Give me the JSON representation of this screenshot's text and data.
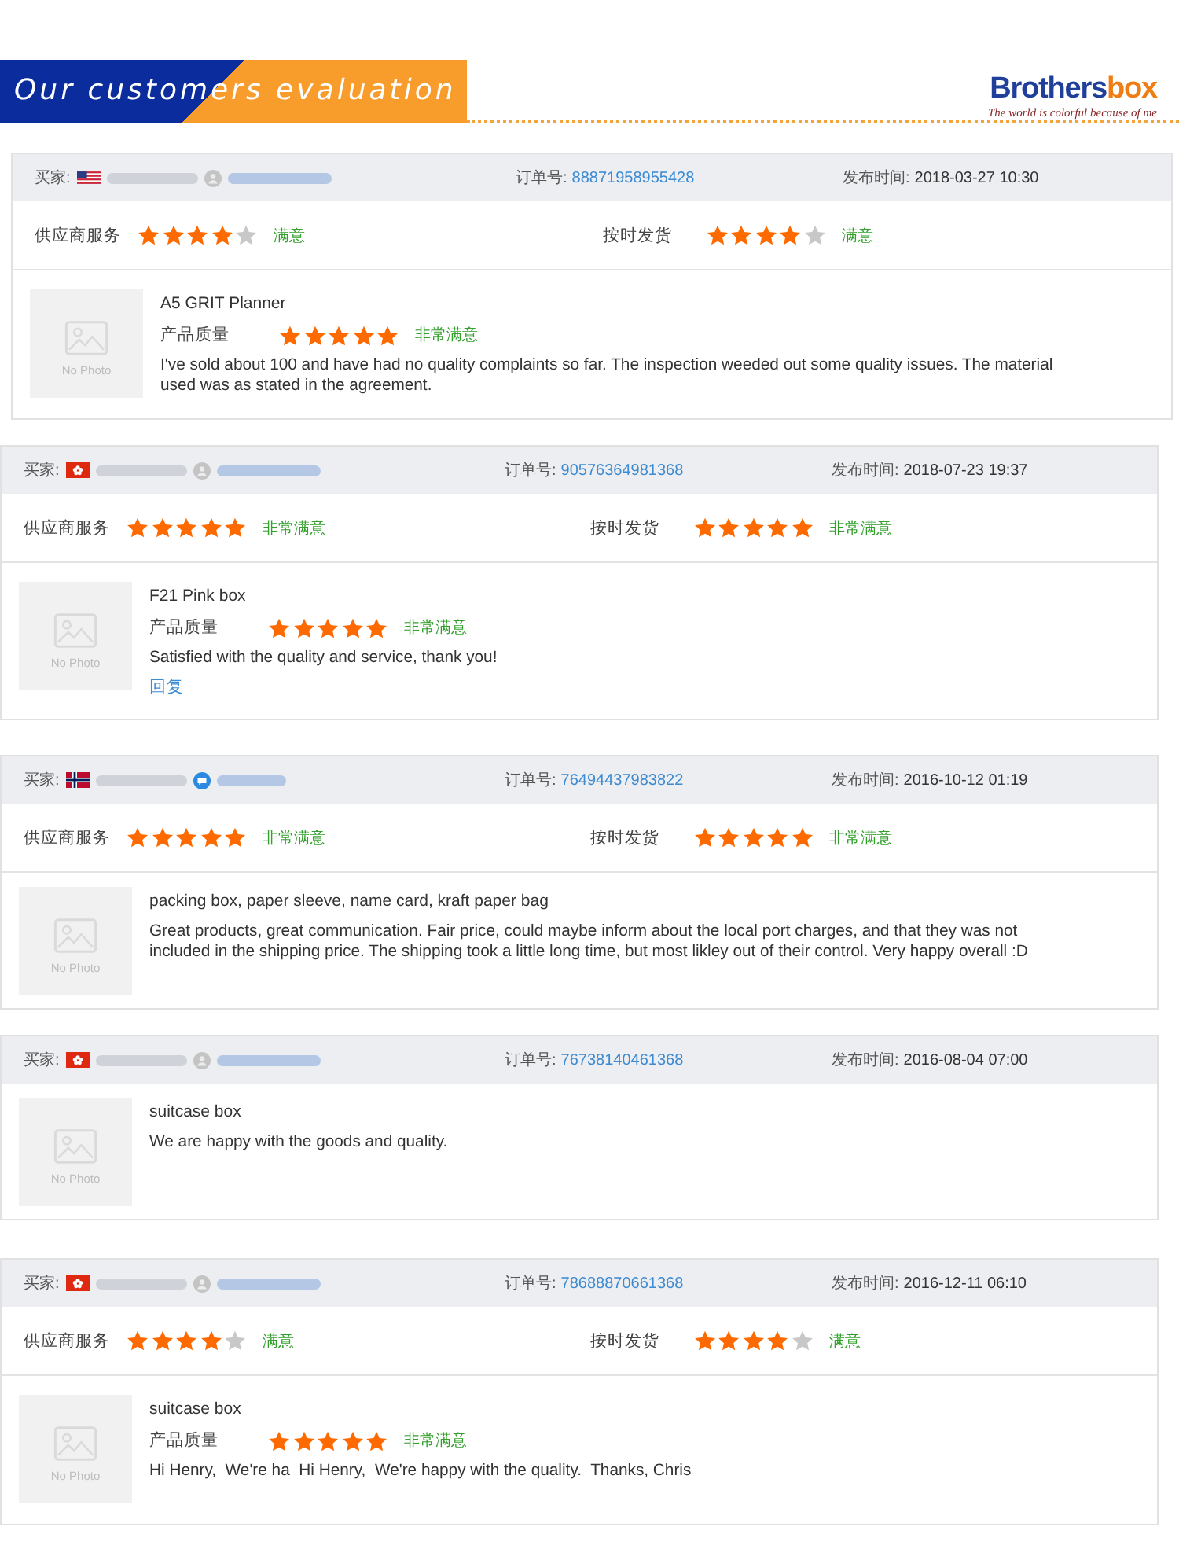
{
  "header": {
    "banner_title": "Our customers evaluation",
    "logo": {
      "primary": "Brothers",
      "accent": "box"
    },
    "tagline": "The world is colorful because of me"
  },
  "reviews": [
    {
      "buyer_label": "买家:",
      "flag": {
        "kind": "us"
      },
      "contact_icon": {
        "kind": "message"
      },
      "order_label": "订单号:",
      "order_number": "88871958955428",
      "time_label": "发布时间:",
      "time": "2018-03-27 10:30",
      "ratings": [
        {
          "label": "供应商服务",
          "stars": 4,
          "verdict": "满意"
        },
        {
          "label": "按时发货",
          "stars": 4,
          "verdict": "满意"
        }
      ],
      "photo_label": "No Photo",
      "product": "A5 GRIT Planner",
      "quality": {
        "label": "产品质量",
        "stars": 5,
        "verdict": "非常满意"
      },
      "comment": "I've sold about 100 and have had no quality complaints so far. The inspection weeded out some quality issues. The material used was as stated in the agreement."
    },
    {
      "buyer_label": "买家:",
      "flag": {
        "kind": "hk"
      },
      "contact_icon": {
        "kind": "message"
      },
      "order_label": "订单号:",
      "order_number": "90576364981368",
      "time_label": "发布时间:",
      "time": "2018-07-23 19:37",
      "ratings": [
        {
          "label": "供应商服务",
          "stars": 5,
          "verdict": "非常满意"
        },
        {
          "label": "按时发货",
          "stars": 5,
          "verdict": "非常满意"
        }
      ],
      "photo_label": "No Photo",
      "product": "F21 Pink box",
      "quality": {
        "label": "产品质量",
        "stars": 5,
        "verdict": "非常满意"
      },
      "comment": "Satisfied with the quality and service, thank you!",
      "reply": "回复"
    },
    {
      "buyer_label": "买家:",
      "flag": {
        "kind": "no"
      },
      "contact_icon": {
        "kind": "chat"
      },
      "order_label": "订单号:",
      "order_number": "76494437983822",
      "time_label": "发布时间:",
      "time": "2016-10-12 01:19",
      "ratings": [
        {
          "label": "供应商服务",
          "stars": 5,
          "verdict": "非常满意"
        },
        {
          "label": "按时发货",
          "stars": 5,
          "verdict": "非常满意"
        }
      ],
      "photo_label": "No Photo",
      "product": "packing box, paper sleeve, name card, kraft paper bag",
      "comment": "Great products, great communication. Fair price, could maybe inform about the local port charges, and that they was not included in the shipping price. The shipping took a little long time, but most likley out of their control. Very happy overall :D"
    },
    {
      "buyer_label": "买家:",
      "flag": {
        "kind": "hk"
      },
      "contact_icon": {
        "kind": "message"
      },
      "order_label": "订单号:",
      "order_number": "76738140461368",
      "time_label": "发布时间:",
      "time": "2016-08-04 07:00",
      "photo_label": "No Photo",
      "product": "suitcase box",
      "comment": "We are happy with the goods and quality."
    },
    {
      "buyer_label": "买家:",
      "flag": {
        "kind": "hk"
      },
      "contact_icon": {
        "kind": "message"
      },
      "order_label": "订单号:",
      "order_number": "78688870661368",
      "time_label": "发布时间:",
      "time": "2016-12-11 06:10",
      "ratings": [
        {
          "label": "供应商服务",
          "stars": 4,
          "verdict": "满意"
        },
        {
          "label": "按时发货",
          "stars": 4,
          "verdict": "满意"
        }
      ],
      "photo_label": "No Photo",
      "product": "suitcase box",
      "quality": {
        "label": "产品质量",
        "stars": 5,
        "verdict": "非常满意"
      },
      "comment": "Hi Henry,  We're ha  Hi Henry,  We're happy with the quality.  Thanks, Chris"
    }
  ]
}
